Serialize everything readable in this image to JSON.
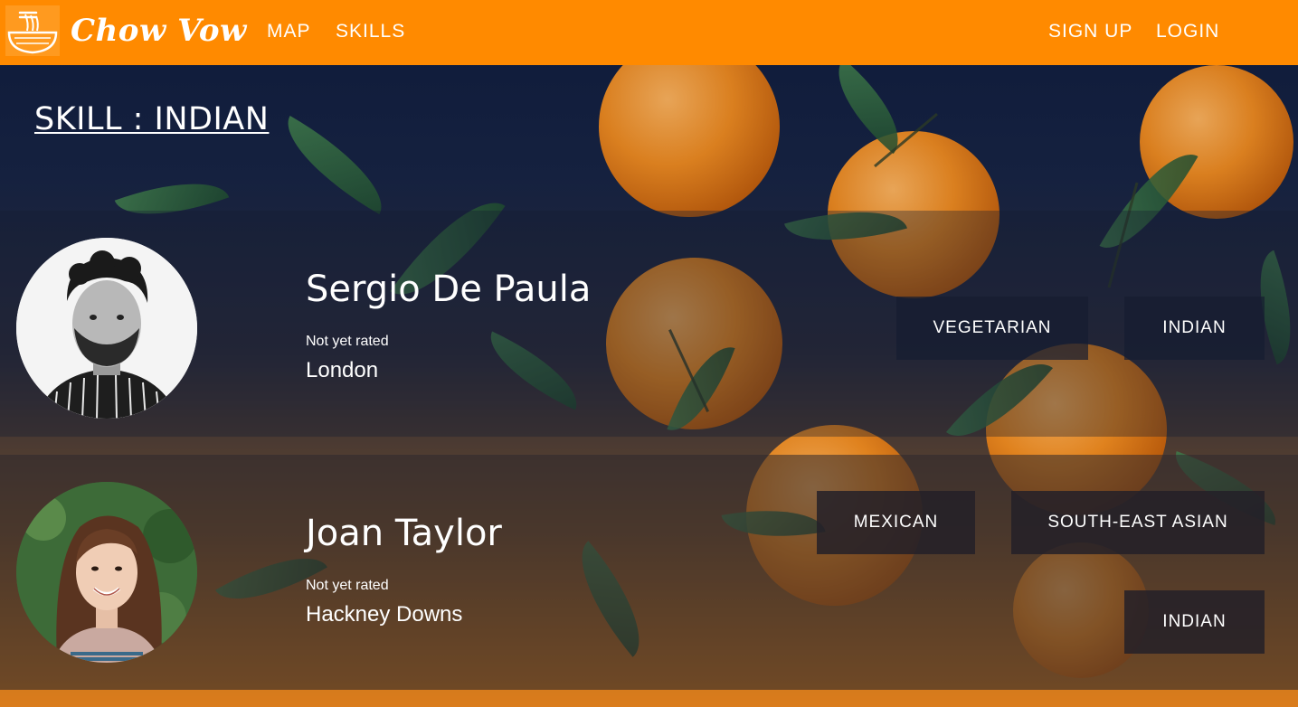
{
  "navbar": {
    "brand": "Chow Vow",
    "logo_icon": "noodle-bowl-icon",
    "links": {
      "map": "MAP",
      "skills": "SKILLS",
      "sign_up": "SIGN UP",
      "login": "LOGIN"
    },
    "color": "#ff8a00"
  },
  "page": {
    "title": "SKILL : INDIAN"
  },
  "profiles": [
    {
      "name": "Sergio De Paula",
      "rating": "Not yet rated",
      "location": "London",
      "skills": [
        "VEGETARIAN",
        "INDIAN"
      ]
    },
    {
      "name": "Joan Taylor",
      "rating": "Not yet rated",
      "location": "Hackney Downs",
      "skills": [
        "MEXICAN",
        "SOUTH-EAST ASIAN",
        "INDIAN"
      ]
    }
  ]
}
